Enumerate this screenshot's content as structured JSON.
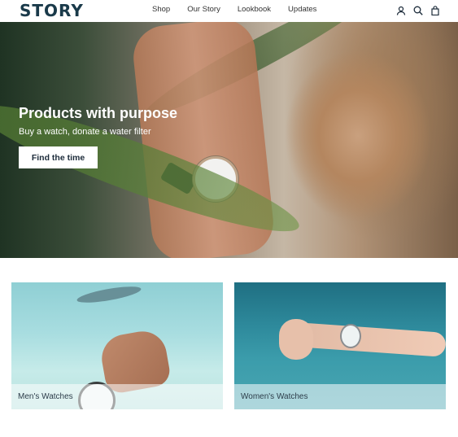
{
  "header": {
    "logo": "STORY",
    "nav": [
      "Shop",
      "Our Story",
      "Lookbook",
      "Updates"
    ],
    "icons": [
      "account-icon",
      "search-icon",
      "cart-icon"
    ]
  },
  "hero": {
    "title": "Products with purpose",
    "subtitle": "Buy a watch, donate a water filter",
    "button": "Find the time"
  },
  "collections": [
    {
      "label": "Men's Watches"
    },
    {
      "label": "Women's Watches"
    }
  ],
  "colors": {
    "logo": "#1a3a4a",
    "text": "#1c2b3a"
  }
}
